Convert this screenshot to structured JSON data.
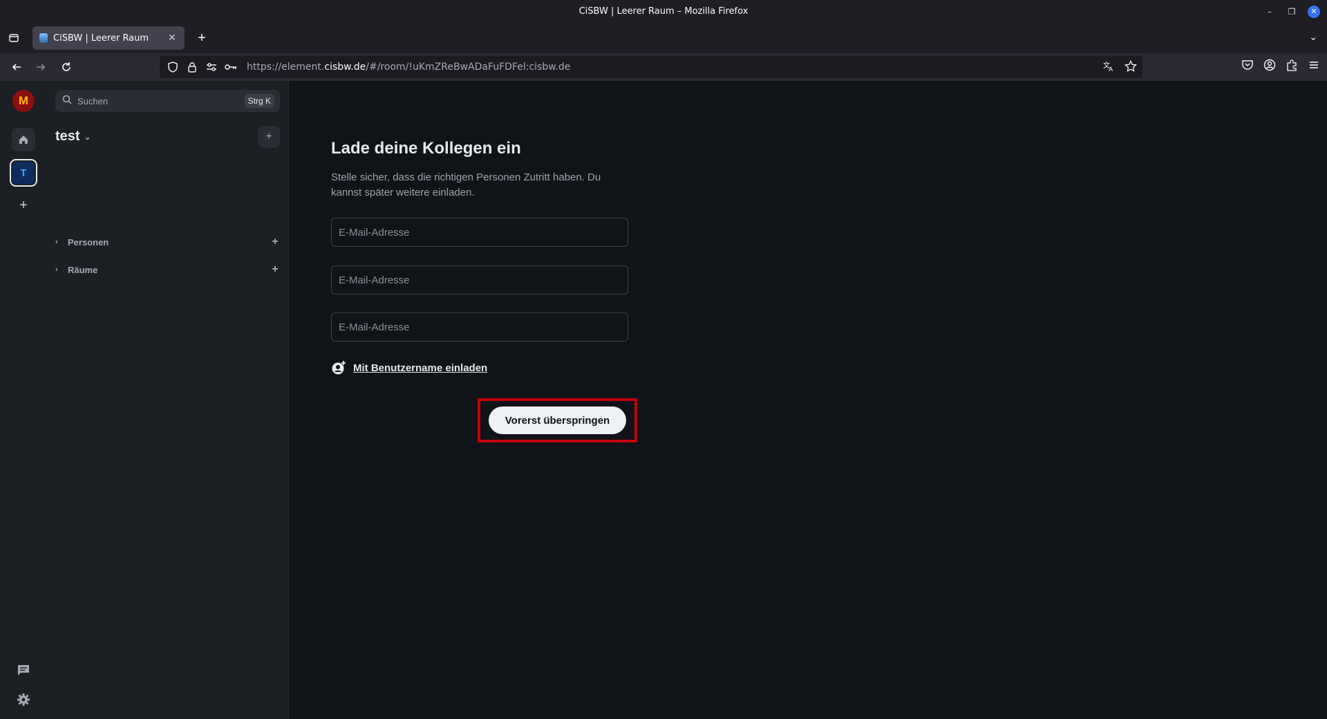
{
  "window": {
    "title": "CiSBW | Leerer Raum – Mozilla Firefox"
  },
  "tabs": [
    {
      "title": "CiSBW | Leerer Raum",
      "active": true
    }
  ],
  "urlbar": {
    "url_prefix": "https://element.",
    "url_domain": "cisbw.de",
    "url_suffix": "/#/room/!uKmZReBwADaFuFDFel:cisbw.de"
  },
  "spacebar": {
    "avatar_letter": "M",
    "space_letter": "T"
  },
  "roomlist": {
    "search_placeholder": "Suchen",
    "search_shortcut": "Strg K",
    "space_name": "test",
    "sections": [
      {
        "label": "Personen"
      },
      {
        "label": "Räume"
      }
    ]
  },
  "main": {
    "heading": "Lade deine Kollegen ein",
    "subtext": "Stelle sicher, dass die richtigen Personen Zutritt haben. Du kannst später weitere einladen.",
    "email_placeholder": "E-Mail-Adresse",
    "invite_by_username": "Mit Benutzername einladen",
    "skip_button": "Vorerst überspringen"
  },
  "colors": {
    "accent_highlight": "#c4000a",
    "space_avatar_bg": "#8b0f0f",
    "space_avatar_fg": "#ffb800"
  }
}
